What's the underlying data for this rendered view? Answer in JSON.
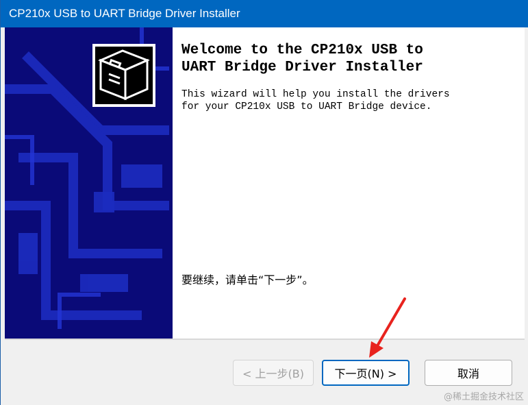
{
  "window": {
    "title": "CP210x USB to UART Bridge Driver Installer"
  },
  "wizard": {
    "heading": "Welcome to the CP210x USB to\nUART Bridge Driver Installer",
    "intro": "This wizard will help you install the drivers\nfor your CP210x USB to UART Bridge device.",
    "instruction": "要继续，请单击“下一步”。"
  },
  "buttons": {
    "back_label": "< 上一步(B)",
    "next_label": "下一页(N) >",
    "cancel_label": "取消"
  },
  "watermark": "@稀土掘金技术社区",
  "colors": {
    "titlebar": "#0067c0",
    "side_banner": "#0a0a78",
    "annotation_arrow": "#e8231e"
  },
  "icons": {
    "logo": "installer-box-icon",
    "annotation": "red-arrow-icon"
  }
}
